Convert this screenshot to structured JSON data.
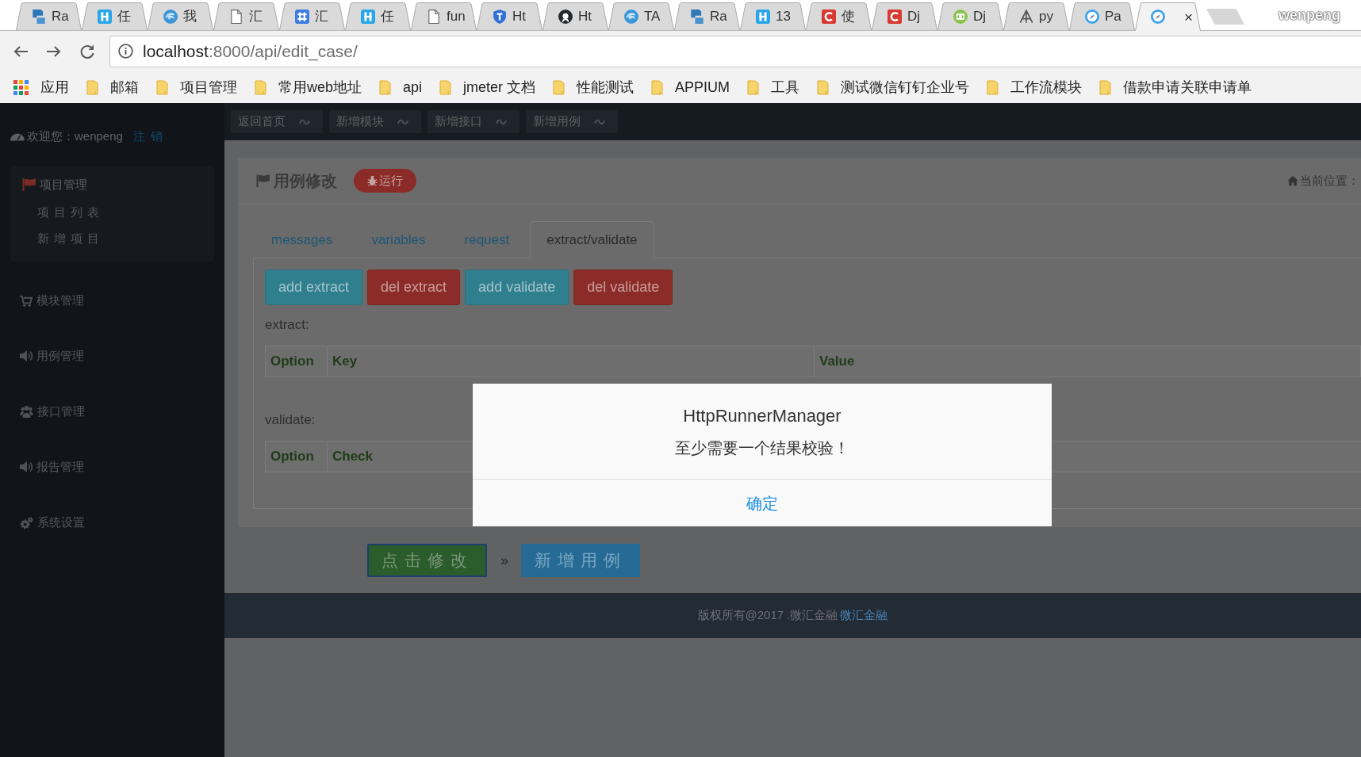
{
  "browser": {
    "tabs": [
      {
        "title": "Ra",
        "selected": false
      },
      {
        "title": "任",
        "selected": false
      },
      {
        "title": "我",
        "selected": false
      },
      {
        "title": "汇",
        "selected": false
      },
      {
        "title": "汇",
        "selected": false
      },
      {
        "title": "任",
        "selected": false
      },
      {
        "title": "fun",
        "selected": false
      },
      {
        "title": "Ht",
        "selected": false
      },
      {
        "title": "Ht",
        "selected": false
      },
      {
        "title": "TA",
        "selected": false
      },
      {
        "title": "Ra",
        "selected": false
      },
      {
        "title": "13",
        "selected": false
      },
      {
        "title": "使",
        "selected": false
      },
      {
        "title": "Dj",
        "selected": false
      },
      {
        "title": "Dj",
        "selected": false
      },
      {
        "title": "py",
        "selected": false
      },
      {
        "title": "Pa",
        "selected": false
      },
      {
        "selected": true,
        "close": "×"
      }
    ],
    "profile": "wenpeng",
    "address_bar": {
      "url": "localhost:8000/api/edit_case/"
    },
    "bookmarks": [
      {
        "kind": "apps",
        "label": "应用"
      },
      {
        "kind": "folder",
        "label": "邮箱"
      },
      {
        "kind": "folder",
        "label": "项目管理"
      },
      {
        "kind": "folder",
        "label": "常用web地址"
      },
      {
        "kind": "folder",
        "label": "api"
      },
      {
        "kind": "folder",
        "label": "jmeter 文档"
      },
      {
        "kind": "folder",
        "label": "性能测试"
      },
      {
        "kind": "folder",
        "label": "APPIUM"
      },
      {
        "kind": "folder",
        "label": "工具"
      },
      {
        "kind": "folder",
        "label": "测试微信钉钉企业号"
      },
      {
        "kind": "folder",
        "label": "工作流模块"
      },
      {
        "kind": "folder",
        "label": "借款申请关联申请单"
      }
    ]
  },
  "sidebar": {
    "welcome": "欢迎您：wenpeng",
    "logout": "注销",
    "menu": [
      {
        "label": "项目管理",
        "expanded": true,
        "children": [
          {
            "label": "项目列表"
          },
          {
            "label": "新增项目"
          }
        ]
      },
      {
        "label": "模块管理",
        "expanded": false
      },
      {
        "label": "用例管理",
        "expanded": false
      },
      {
        "label": "接口管理",
        "expanded": false
      },
      {
        "label": "报告管理",
        "expanded": false
      },
      {
        "label": "系统设置",
        "expanded": false
      }
    ]
  },
  "top_nav": [
    "返回首页",
    "新增模块",
    "新增接口",
    "新增用例"
  ],
  "panel": {
    "title": "用例修改",
    "run_button": "运行",
    "breadcrumb": "当前位置：",
    "tabs": [
      {
        "label": "messages",
        "selected": false
      },
      {
        "label": "variables",
        "selected": false
      },
      {
        "label": "request",
        "selected": false
      },
      {
        "label": "extract/validate",
        "selected": true
      }
    ],
    "actions": [
      {
        "kind": "add",
        "label": "add extract"
      },
      {
        "kind": "delete",
        "label": "del extract"
      },
      {
        "kind": "add",
        "label": "add validate"
      },
      {
        "kind": "delete",
        "label": "del validate"
      }
    ],
    "extract": {
      "label": "extract:",
      "columns": [
        "Option",
        "Key",
        "Value"
      ]
    },
    "validate": {
      "label": "validate:",
      "columns": [
        "Option",
        "Check"
      ]
    }
  },
  "form_buttons": {
    "submit": "点击修改",
    "separator": "»",
    "add_case": "新增用例"
  },
  "footer": {
    "text": "版权所有@2017 .微汇金融",
    "link": "微汇金融"
  },
  "dialog": {
    "title": "HttpRunnerManager",
    "message": "至少需要一个结果校验！",
    "confirm": "确定"
  }
}
